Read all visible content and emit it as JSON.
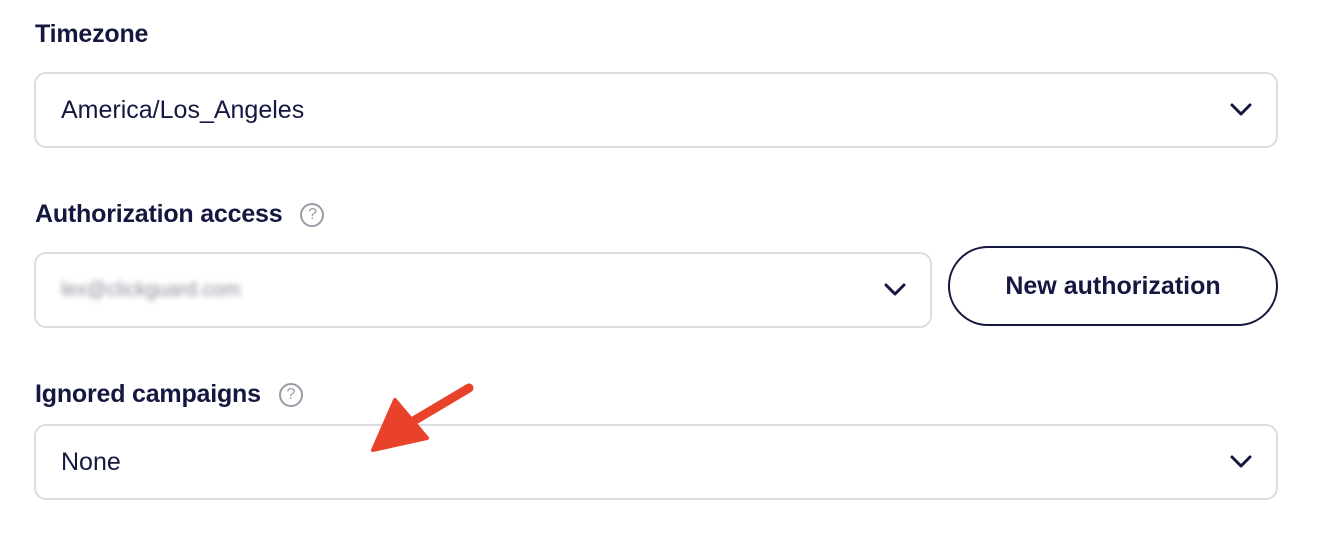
{
  "timezone": {
    "label": "Timezone",
    "value": "America/Los_Angeles"
  },
  "authorization": {
    "label": "Authorization access",
    "help_icon": "?",
    "value": "lex@clickguard.com",
    "button_label": "New authorization"
  },
  "ignored_campaigns": {
    "label": "Ignored campaigns",
    "help_icon": "?",
    "value": "None"
  },
  "icons": {
    "chevron": "chevron-down-icon",
    "help": "question-circle-icon",
    "annotation": "red-arrow-annotation"
  },
  "colors": {
    "text": "#14173f",
    "border": "#dcdde3",
    "help": "#9a9aa6",
    "annotation": "#e8432a"
  }
}
